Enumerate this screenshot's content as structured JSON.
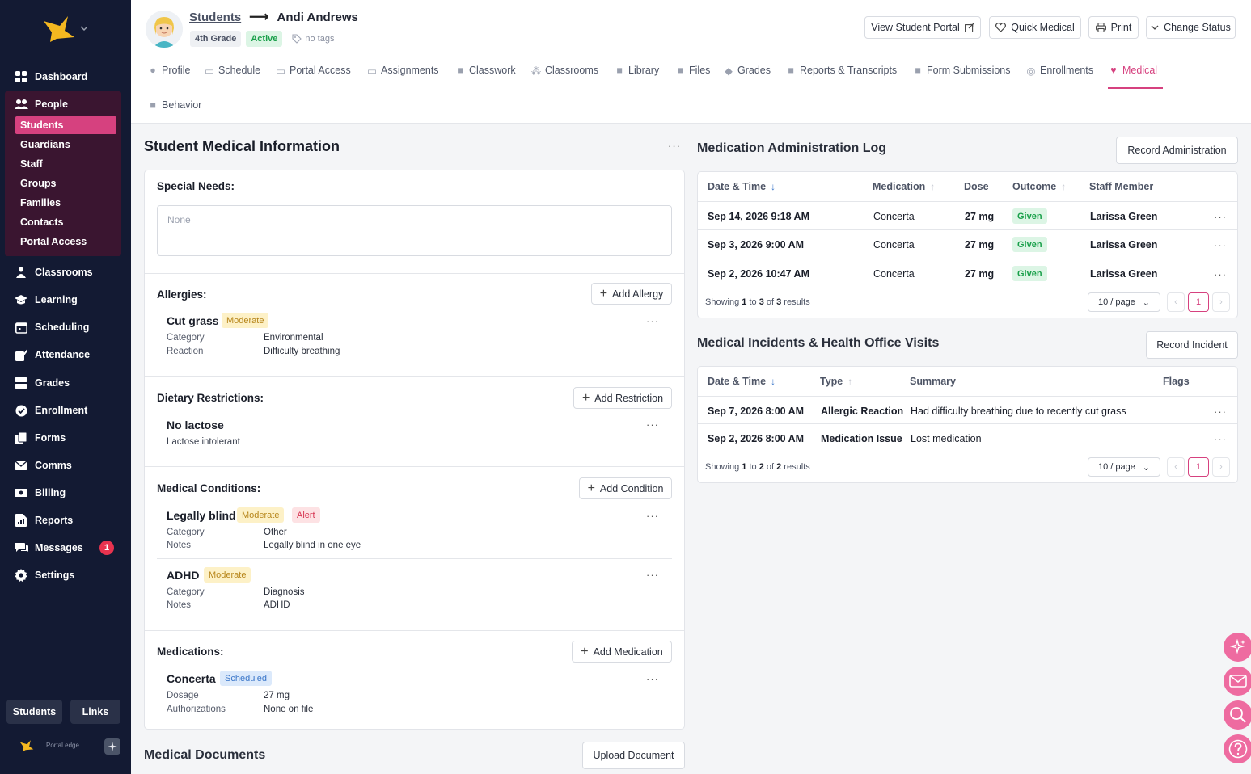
{
  "sidebar": {
    "nav": [
      {
        "label": "Dashboard",
        "icon": "dashboard-icon"
      },
      {
        "label": "People",
        "icon": "people-icon"
      },
      {
        "label": "Classrooms",
        "icon": "classrooms-icon"
      },
      {
        "label": "Learning",
        "icon": "learning-icon"
      },
      {
        "label": "Scheduling",
        "icon": "calendar-icon"
      },
      {
        "label": "Attendance",
        "icon": "attendance-icon"
      },
      {
        "label": "Grades",
        "icon": "grades-icon"
      },
      {
        "label": "Enrollment",
        "icon": "enrollment-icon"
      },
      {
        "label": "Forms",
        "icon": "forms-icon"
      },
      {
        "label": "Comms",
        "icon": "mail-icon"
      },
      {
        "label": "Billing",
        "icon": "billing-icon"
      },
      {
        "label": "Reports",
        "icon": "reports-icon"
      },
      {
        "label": "Messages",
        "icon": "messages-icon"
      },
      {
        "label": "Settings",
        "icon": "gear-icon"
      }
    ],
    "people_sub": [
      "Students",
      "Guardians",
      "Staff",
      "Groups",
      "Families",
      "Contacts",
      "Portal Access"
    ],
    "messages_badge": "1",
    "bottom_buttons": [
      "Students",
      "Links"
    ],
    "footer_text": "Portal edge"
  },
  "header": {
    "breadcrumb_link": "Students",
    "student_name": "Andi Andrews",
    "grade": "4th Grade",
    "status": "Active",
    "tags": "no tags",
    "buttons": [
      "View Student Portal",
      "Quick Medical",
      "Print",
      "Change Status"
    ],
    "tabs": [
      "Profile",
      "Schedule",
      "Portal Access",
      "Assignments",
      "Classwork",
      "Classrooms",
      "Library",
      "Files",
      "Grades",
      "Reports & Transcripts",
      "Form Submissions",
      "Enrollments",
      "Medical",
      "Behavior"
    ],
    "active_tab": "Medical"
  },
  "medical": {
    "title": "Student Medical Information",
    "special_needs": {
      "label": "Special Needs:",
      "placeholder": "None"
    },
    "allergies": {
      "label": "Allergies:",
      "add_label": "Add Allergy",
      "name": "Cut grass",
      "severity": "Moderate",
      "fields": [
        {
          "k": "Category",
          "v": "Environmental"
        },
        {
          "k": "Reaction",
          "v": "Difficulty breathing"
        }
      ]
    },
    "dietary": {
      "label": "Dietary Restrictions:",
      "add_label": "Add Restriction",
      "name": "No lactose",
      "desc": "Lactose intolerant"
    },
    "conditions": {
      "label": "Medical Conditions:",
      "add_label": "Add Condition",
      "items": [
        {
          "name": "Legally blind",
          "severity": "Moderate",
          "alert": "Alert",
          "fields": [
            {
              "k": "Category",
              "v": "Other"
            },
            {
              "k": "Notes",
              "v": "Legally blind in one eye"
            }
          ]
        },
        {
          "name": "ADHD",
          "severity": "Moderate",
          "fields": [
            {
              "k": "Category",
              "v": "Diagnosis"
            },
            {
              "k": "Notes",
              "v": "ADHD"
            }
          ]
        }
      ]
    },
    "medications": {
      "label": "Medications:",
      "add_label": "Add Medication",
      "name": "Concerta",
      "status": "Scheduled",
      "fields": [
        {
          "k": "Dosage",
          "v": "27 mg"
        },
        {
          "k": "Authorizations",
          "v": "None on file"
        }
      ]
    },
    "documents": {
      "title": "Medical Documents",
      "upload_label": "Upload Document"
    }
  },
  "admin_log": {
    "title": "Medication Administration Log",
    "button": "Record Administration",
    "columns": [
      "Date & Time",
      "Medication",
      "Dose",
      "Outcome",
      "Staff Member"
    ],
    "rows": [
      {
        "date": "Sep 14, 2026 9:18 AM",
        "medication": "Concerta",
        "dose": "27 mg",
        "outcome": "Given",
        "staff": "Larissa Green"
      },
      {
        "date": "Sep 3, 2026 9:00 AM",
        "medication": "Concerta",
        "dose": "27 mg",
        "outcome": "Given",
        "staff": "Larissa Green"
      },
      {
        "date": "Sep 2, 2026 10:47 AM",
        "medication": "Concerta",
        "dose": "27 mg",
        "outcome": "Given",
        "staff": "Larissa Green"
      }
    ],
    "showing": {
      "pre": "Showing ",
      "from": "1",
      "mid1": " to ",
      "to": "3",
      "mid2": " of ",
      "total": "3",
      "post": " results"
    },
    "per_page": "10 / page",
    "page": "1"
  },
  "incidents": {
    "title": "Medical Incidents & Health Office Visits",
    "button": "Record Incident",
    "columns": [
      "Date & Time",
      "Type",
      "Summary",
      "Flags"
    ],
    "rows": [
      {
        "date": "Sep 7, 2026 8:00 AM",
        "type": "Allergic Reaction",
        "summary": "Had difficulty breathing due to recently cut grass"
      },
      {
        "date": "Sep 2, 2026 8:00 AM",
        "type": "Medication Issue",
        "summary": "Lost medication"
      }
    ],
    "showing": {
      "pre": "Showing ",
      "from": "1",
      "mid1": " to ",
      "to": "2",
      "mid2": " of ",
      "total": "2",
      "post": " results"
    },
    "per_page": "10 / page",
    "page": "1"
  },
  "colors": {
    "accent": "#d6417f",
    "sidebar": "#131a33",
    "success": "#19a04a"
  }
}
